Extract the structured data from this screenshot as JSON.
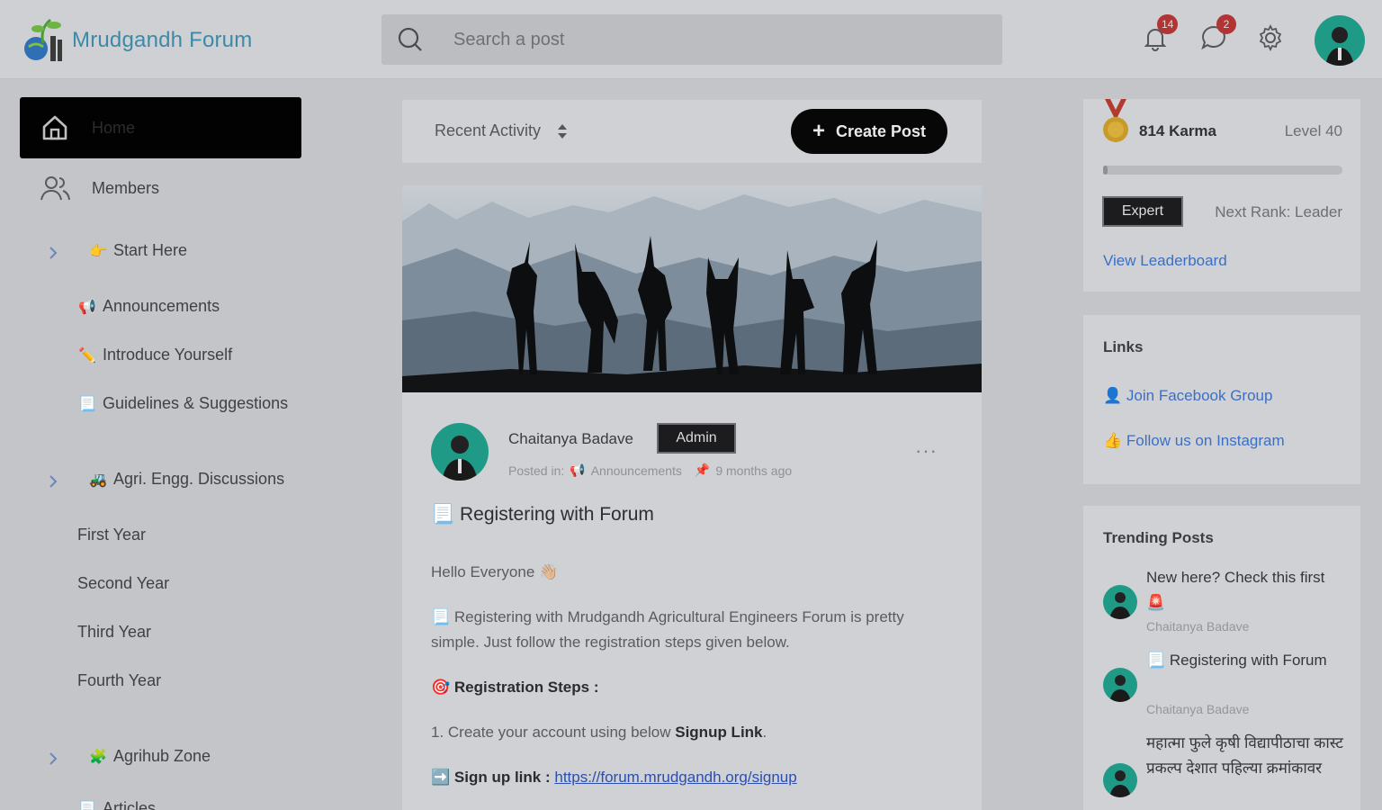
{
  "header": {
    "logo_text": "Mrudgandh Forum",
    "search_placeholder": "Search a post",
    "notifications_count": "14",
    "messages_count": "2"
  },
  "sidebar": {
    "home_label": "Home",
    "members_label": "Members",
    "start_here": {
      "emoji": "👉",
      "label": "Start Here"
    },
    "start_children": [
      {
        "emoji": "📢",
        "label": "Announcements"
      },
      {
        "emoji": "✏️",
        "label": "Introduce Yourself"
      },
      {
        "emoji": "📃",
        "label": "Guidelines & Suggestions"
      }
    ],
    "agri_engg": {
      "emoji": "🚜",
      "label": "Agri. Engg. Discussions"
    },
    "agri_children": [
      "First Year",
      "Second Year",
      "Third Year",
      "Fourth Year"
    ],
    "agrihub": {
      "emoji": "🧩",
      "label": "Agrihub Zone"
    },
    "agrihub_children_partial": "Articles"
  },
  "feed": {
    "sort_label": "Recent Activity",
    "create_post_label": "Create Post",
    "post": {
      "author": "Chaitanya Badave",
      "author_tag": "Admin",
      "posted_in_prefix": "Posted in:",
      "category_emoji": "📢",
      "category": "Announcements",
      "pin_icon": "📌",
      "time": "9 months ago",
      "title_emoji": "📃",
      "title": "Registering with Forum",
      "greeting": "Hello Everyone",
      "greeting_emoji": "👋🏼",
      "intro_emoji": "📃",
      "intro": "Registering with Mrudgandh Agricultural Engineers Forum is pretty simple. Just follow the registration steps given below.",
      "steps_emoji": "🎯",
      "steps_heading": "Registration Steps :",
      "step1_prefix": "1. Create your account using below",
      "step1_bold": "Signup Link",
      "step1_suffix": ".",
      "signup_emoji": "➡️",
      "signup_label": "Sign up link :",
      "signup_url": "https://forum.mrudgandh.org/signup"
    }
  },
  "karma": {
    "karma_text": "814 Karma",
    "level_text": "Level 40",
    "progress": 0.02,
    "rank_badge": "Expert",
    "next_rank": "Next Rank: Leader",
    "leaderboard_link": "View Leaderboard"
  },
  "links": {
    "title": "Links",
    "items": [
      {
        "emoji": "👤",
        "label": "Join Facebook Group"
      },
      {
        "emoji": "👍",
        "label": "Follow us on Instagram"
      }
    ]
  },
  "trending": {
    "title": "Trending Posts",
    "items": [
      {
        "title": "New here? Check this first 🚨",
        "author": "Chaitanya Badave"
      },
      {
        "title": "📃 Registering with Forum",
        "author": "Chaitanya Badave"
      },
      {
        "title": "महात्मा फुले कृषी विद्यापीठाचा कास्ट प्रकल्प देशात पहिल्या क्रमांकावर",
        "author": ""
      }
    ]
  },
  "colors": {
    "accent_dark": "#070707",
    "brand": "#3c8aa8",
    "link": "#3b6fc6",
    "avatar_bg": "#1f9a86"
  }
}
